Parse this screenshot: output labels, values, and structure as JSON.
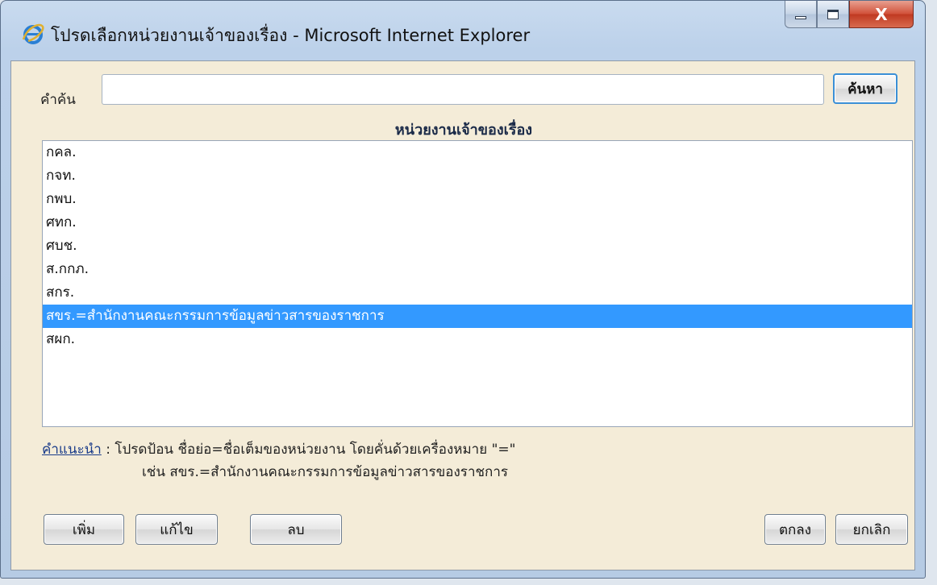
{
  "window": {
    "title": "โปรดเลือกหน่วยงานเจ้าของเรื่อง - Microsoft Internet Explorer",
    "close_glyph": "X"
  },
  "search": {
    "label": "คำค้น",
    "value": "",
    "button_label": "ค้นหา"
  },
  "list": {
    "heading": "หน่วยงานเจ้าของเรื่อง",
    "items": [
      "กคล.",
      "กจท.",
      "กพบ.",
      "ศทก.",
      "ศบช.",
      "ส.กกภ.",
      "สกร.",
      "สขร.=สำนักงานคณะกรรมการข้อมูลข่าวสารของราชการ",
      "สผก."
    ],
    "selected_index": 7
  },
  "hint": {
    "link_label": "คำแนะนำ",
    "line1": " : โปรดป้อน ชื่อย่อ=ชื่อเต็มของหน่วยงาน โดยคั่นด้วยเครื่องหมาย \"=\"",
    "line2": "เช่น สขร.=สำนักงานคณะกรรมการข้อมูลข่าวสารของราชการ"
  },
  "buttons": {
    "add": "เพิ่ม",
    "edit": "แก้ไข",
    "delete": "ลบ",
    "ok": "ตกลง",
    "cancel": "ยกเลิก"
  },
  "icons": {
    "app": "internet-explorer-icon",
    "minimize": "minimize-icon",
    "maximize": "maximize-icon",
    "close": "close-icon"
  },
  "colors": {
    "selection": "#3399ff",
    "dialog_background": "#f4ecd8"
  }
}
